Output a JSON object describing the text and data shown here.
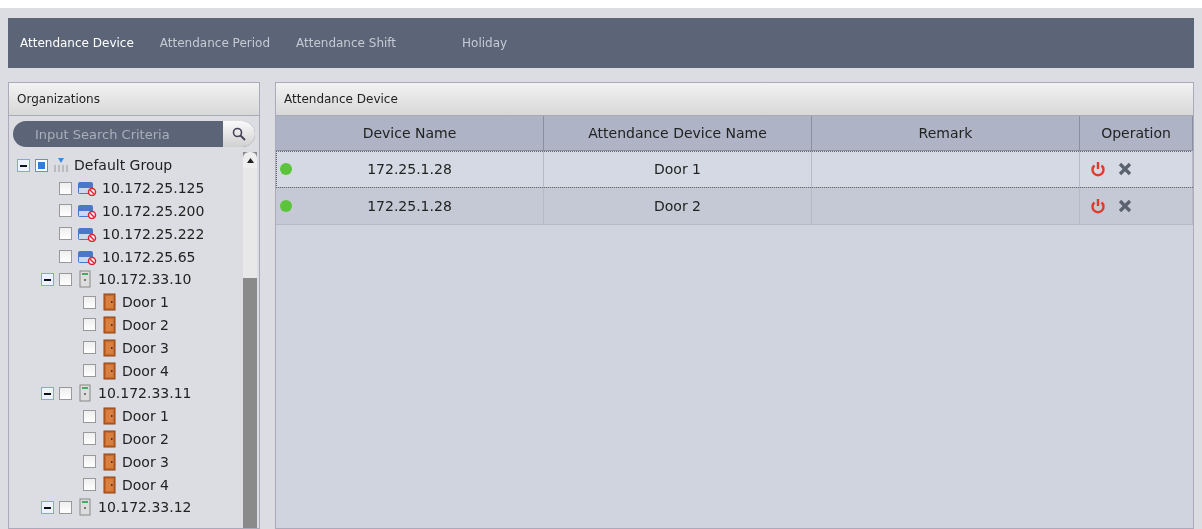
{
  "nav_tabs": [
    {
      "label": "Attendance Device",
      "selected": true
    },
    {
      "label": "Attendance Period",
      "selected": false
    },
    {
      "label": "Attendance Shift",
      "selected": false
    },
    {
      "label": "Holiday",
      "selected": false
    }
  ],
  "organizations": {
    "title": "Organizations",
    "search": {
      "placeholder": "Input Search Criteria"
    },
    "tree": [
      {
        "label": "Default Group",
        "kind": "group",
        "checked": true,
        "expanded": true,
        "children": [
          {
            "label": "10.172.25.125",
            "kind": "dvr",
            "checked": false
          },
          {
            "label": "10.172.25.200",
            "kind": "dvr",
            "checked": false
          },
          {
            "label": "10.172.25.222",
            "kind": "dvr",
            "checked": false
          },
          {
            "label": "10.172.25.65",
            "kind": "dvr",
            "checked": false
          },
          {
            "label": "10.172.33.10",
            "kind": "controller",
            "checked": false,
            "expanded": true,
            "children": [
              {
                "label": "Door 1",
                "kind": "door",
                "checked": false
              },
              {
                "label": "Door 2",
                "kind": "door",
                "checked": false
              },
              {
                "label": "Door 3",
                "kind": "door",
                "checked": false
              },
              {
                "label": "Door 4",
                "kind": "door",
                "checked": false
              }
            ]
          },
          {
            "label": "10.172.33.11",
            "kind": "controller",
            "checked": false,
            "expanded": true,
            "children": [
              {
                "label": "Door 1",
                "kind": "door",
                "checked": false
              },
              {
                "label": "Door 2",
                "kind": "door",
                "checked": false
              },
              {
                "label": "Door 3",
                "kind": "door",
                "checked": false
              },
              {
                "label": "Door 4",
                "kind": "door",
                "checked": false
              }
            ]
          },
          {
            "label": "10.172.33.12",
            "kind": "controller",
            "checked": false,
            "expanded": true
          }
        ]
      }
    ]
  },
  "device_panel": {
    "title": "Attendance Device",
    "columns": [
      "Device Name",
      "Attendance Device Name",
      "Remark",
      "Operation"
    ],
    "rows": [
      {
        "device_name": "172.25.1.28",
        "attendance_device_name": "Door  1",
        "color": "#5cc43a",
        "selected": true
      },
      {
        "device_name": "172.25.1.28",
        "attendance_device_name": "Door  2",
        "color": "#5cc43a",
        "selected": false
      }
    ]
  }
}
